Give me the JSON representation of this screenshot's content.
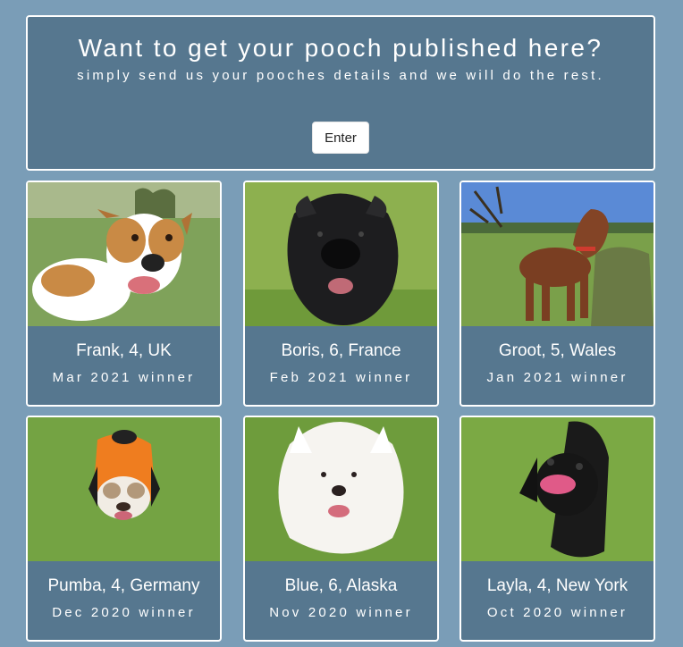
{
  "hero": {
    "title": "Want to get your pooch published here?",
    "subtitle": "simply send us your pooches details and we will do the rest.",
    "enter_label": "Enter"
  },
  "cards": [
    {
      "name": "Frank, 4, UK",
      "caption": "Mar 2021 winner",
      "photo": "jack-russell-mix-dog-photo"
    },
    {
      "name": "Boris, 6, France",
      "caption": "Feb 2021 winner",
      "photo": "black-shaggy-dog-photo"
    },
    {
      "name": "Groot, 5, Wales",
      "caption": "Jan 2021 winner",
      "photo": "brown-vizsla-dog-photo"
    },
    {
      "name": "Pumba, 4, Germany",
      "caption": "Dec 2020 winner",
      "photo": "bulldog-orange-jacket-photo"
    },
    {
      "name": "Blue, 6, Alaska",
      "caption": "Nov 2020 winner",
      "photo": "white-samoyed-dog-photo"
    },
    {
      "name": "Layla, 4, New York",
      "caption": "Oct 2020 winner",
      "photo": "black-labrador-dog-photo"
    }
  ],
  "colors": {
    "page_background": "#7a9db7",
    "panel": "#56778f",
    "border": "#ffffff",
    "grass": "#6e9a3c"
  }
}
